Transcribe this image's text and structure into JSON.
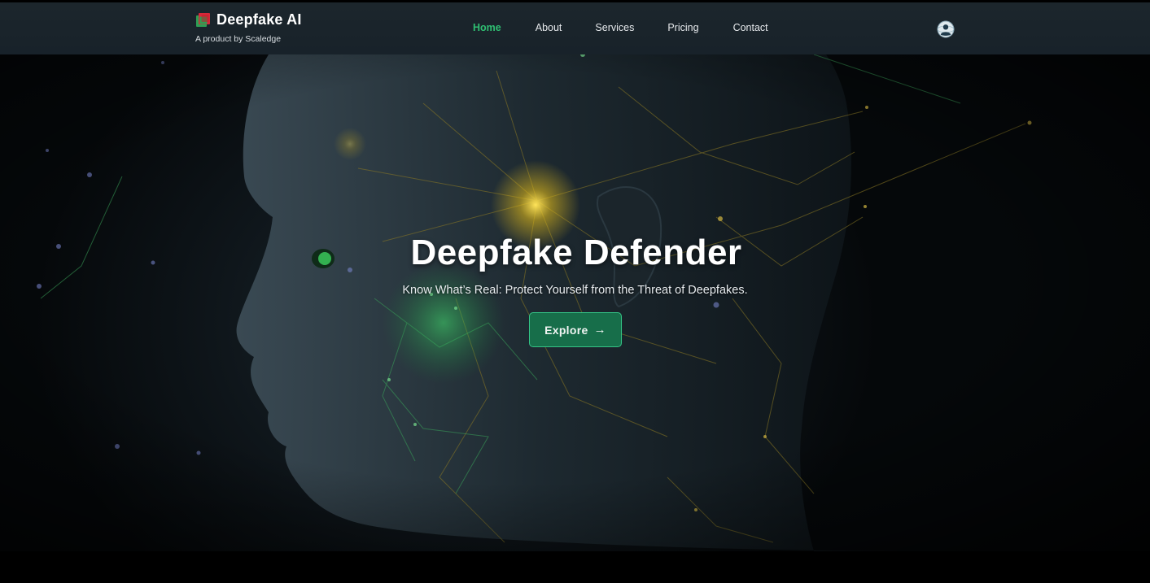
{
  "header": {
    "brand_title": "Deepfake AI",
    "brand_subtitle": "A product by Scaledge",
    "logo_icon": "layered-square-logo",
    "profile_icon": "user-globe-icon"
  },
  "nav": {
    "items": [
      {
        "label": "Home",
        "active": true
      },
      {
        "label": "About",
        "active": false
      },
      {
        "label": "Services",
        "active": false
      },
      {
        "label": "Pricing",
        "active": false
      },
      {
        "label": "Contact",
        "active": false
      }
    ]
  },
  "hero": {
    "title": "Deepfake Defender",
    "subtitle": "Know What’s Real: Protect Yourself from the Threat of Deepfakes.",
    "cta_label": "Explore",
    "cta_arrow": "→",
    "background_image": "AI face profile with neural network lines"
  },
  "colors": {
    "accent": "#2fbf72",
    "cta_bg": "#176e4a",
    "cta_border": "#34c486",
    "nav_bg": "#1a242b",
    "page_bg": "#000000"
  }
}
